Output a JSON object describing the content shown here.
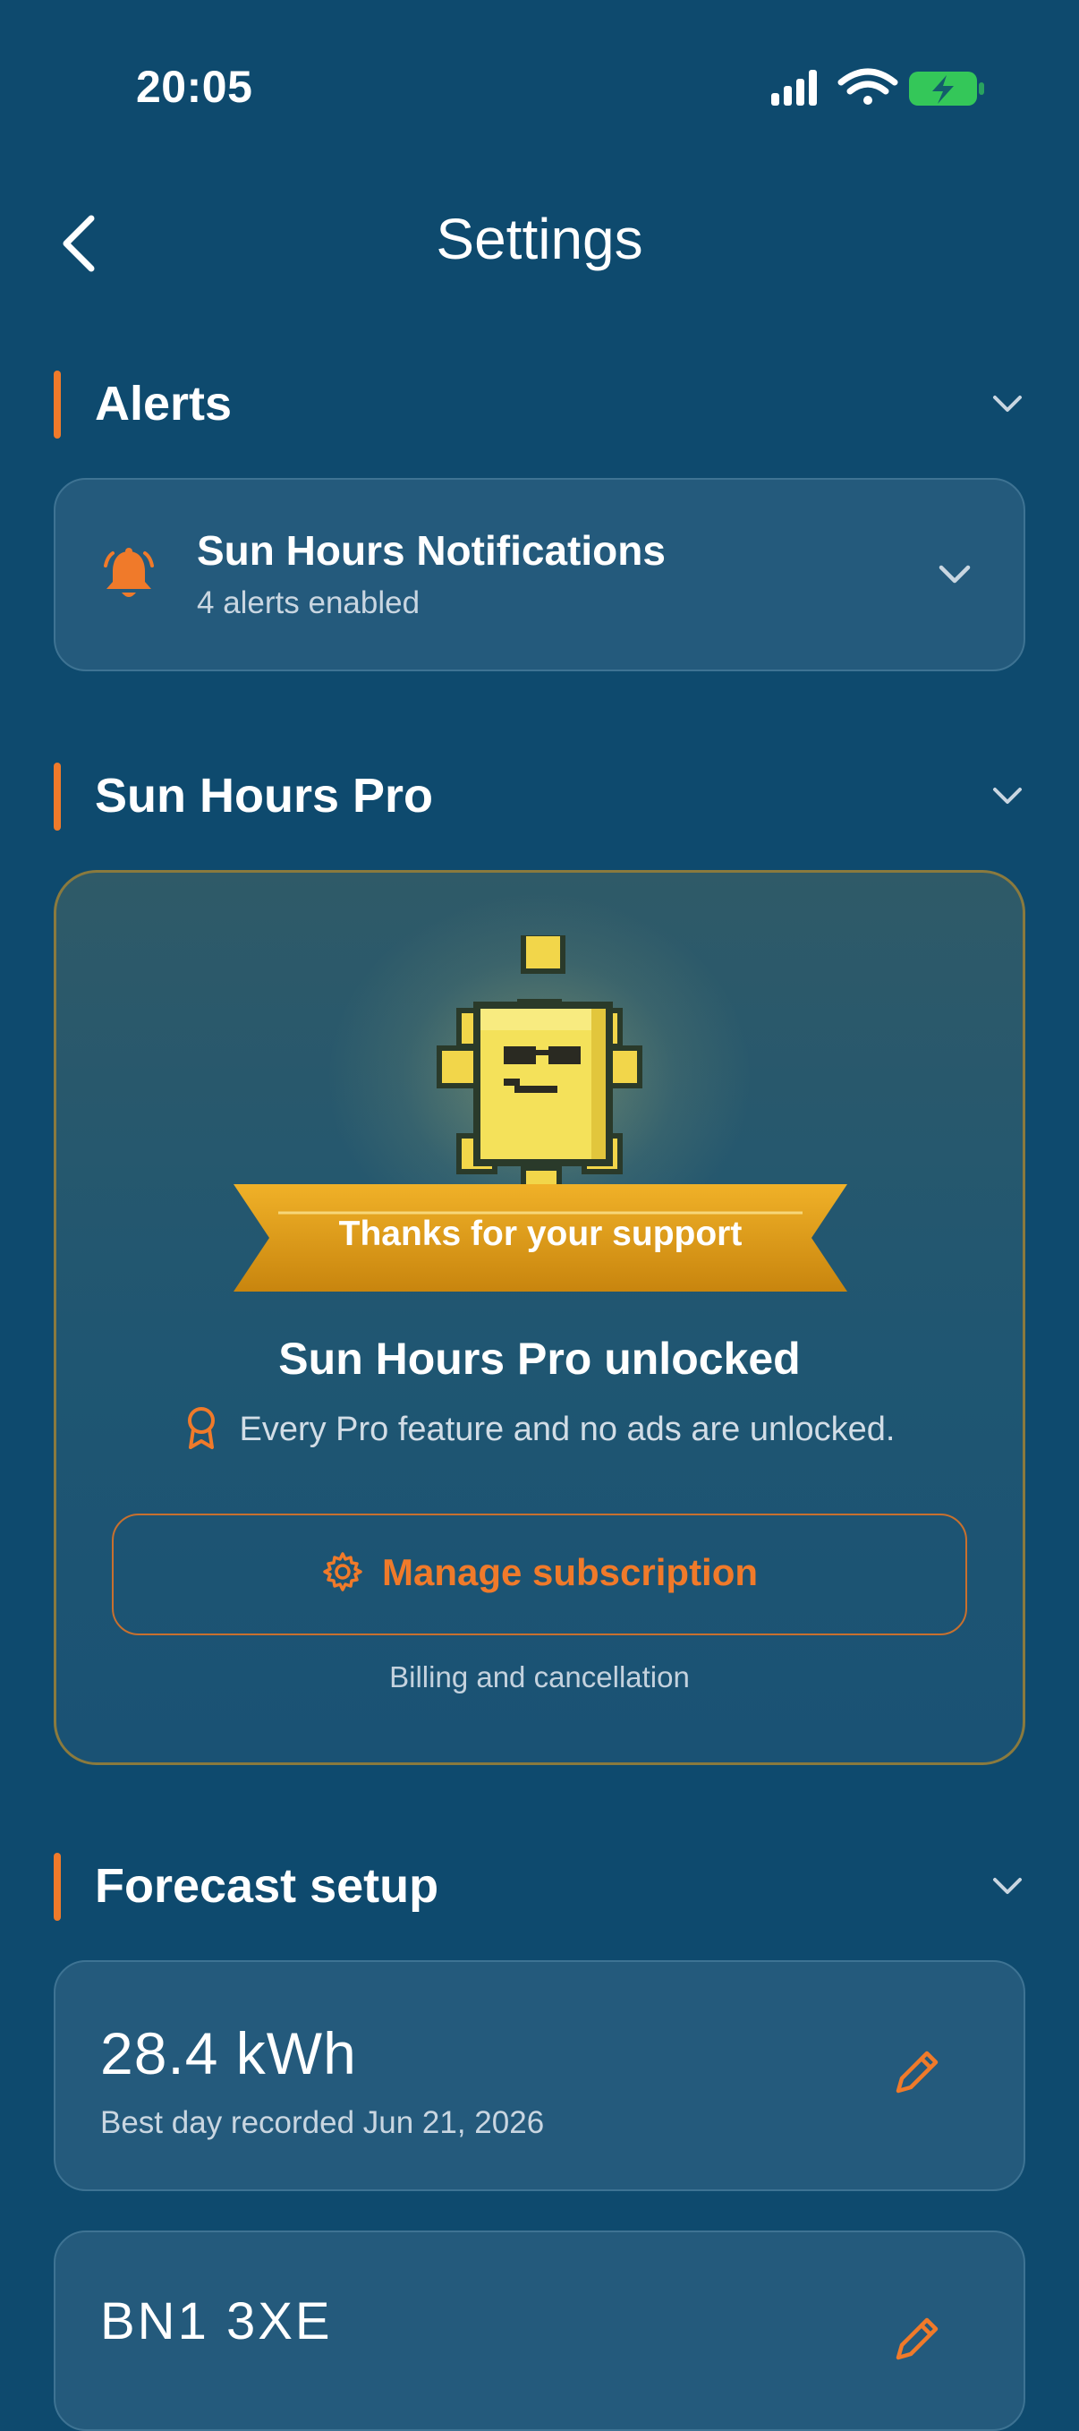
{
  "status_bar": {
    "time": "20:05"
  },
  "header": {
    "title": "Settings"
  },
  "sections": {
    "alerts": {
      "title": "Alerts"
    },
    "pro": {
      "title": "Sun Hours Pro"
    },
    "forecast": {
      "title": "Forecast setup"
    }
  },
  "alerts_card": {
    "title": "Sun Hours Notifications",
    "subtitle": "4 alerts enabled"
  },
  "pro_card": {
    "ribbon": "Thanks for your support",
    "heading": "Sun Hours Pro unlocked",
    "description": "Every Pro feature and no ads are unlocked.",
    "manage_label": "Manage subscription",
    "billing_note": "Billing and cancellation"
  },
  "forecast": {
    "best_day_value": "28.4 kWh",
    "best_day_label": "Best day recorded Jun 21, 2026",
    "postcode": "BN1 3XE"
  },
  "colors": {
    "background": "#0e4a6e",
    "accent": "#f07a2a",
    "card": "#245a7c",
    "sun": "#f2d64a",
    "ribbon": "#e0a020",
    "battery": "#34c759"
  },
  "icons": [
    "back-chevron-icon",
    "bell-icon",
    "chevron-down-icon",
    "sun-mascot-icon",
    "award-ribbon-icon",
    "gear-icon",
    "pencil-icon",
    "signal-icon",
    "wifi-icon",
    "battery-charging-icon"
  ]
}
